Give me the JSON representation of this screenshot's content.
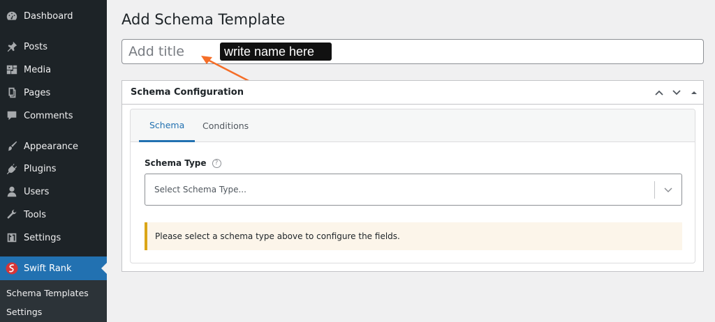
{
  "sidebar": {
    "items": [
      {
        "label": "Dashboard",
        "icon": "dashboard-icon"
      },
      {
        "label": "Posts",
        "icon": "pin-icon"
      },
      {
        "label": "Media",
        "icon": "media-icon"
      },
      {
        "label": "Pages",
        "icon": "pages-icon"
      },
      {
        "label": "Comments",
        "icon": "comment-icon"
      },
      {
        "label": "Appearance",
        "icon": "brush-icon"
      },
      {
        "label": "Plugins",
        "icon": "plugin-icon"
      },
      {
        "label": "Users",
        "icon": "user-icon"
      },
      {
        "label": "Tools",
        "icon": "wrench-icon"
      },
      {
        "label": "Settings",
        "icon": "settings-icon"
      }
    ],
    "current": {
      "label": "Swift Rank",
      "icon": "swift-rank-logo-icon"
    },
    "submenu": [
      "Schema Templates",
      "Settings"
    ]
  },
  "page": {
    "title": "Add Schema Template",
    "title_placeholder": "Add title",
    "callout": "write name here"
  },
  "postbox": {
    "title": "Schema Configuration",
    "tabs": [
      "Schema",
      "Conditions"
    ],
    "field_label": "Schema Type",
    "help_glyph": "?",
    "select_placeholder": "Select Schema Type...",
    "notice": "Please select a schema type above to configure the fields."
  },
  "colors": {
    "sidebar_bg": "#1d2327",
    "accent": "#2271b1",
    "notice_border": "#dba617",
    "callout_arrow": "#f56e28"
  }
}
